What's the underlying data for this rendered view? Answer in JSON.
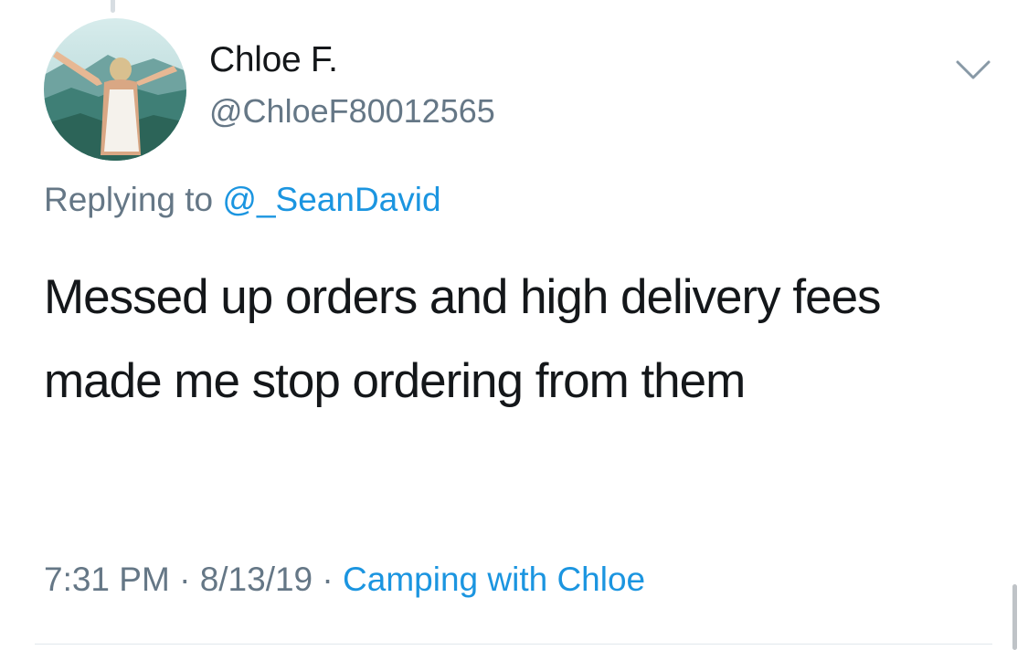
{
  "author": {
    "display_name": "Chloe F.",
    "handle": "@ChloeF80012565",
    "avatar_icon": "profile-photo-mountain"
  },
  "reply": {
    "prefix": "Replying to ",
    "mention": "@_SeanDavid"
  },
  "tweet": {
    "text": "Messed up orders and high delivery fees made me stop ordering from them"
  },
  "meta": {
    "time": "7:31 PM",
    "separator": " · ",
    "date": "8/13/19",
    "source": "Camping with Chloe"
  },
  "icons": {
    "menu": "chevron-down-icon"
  },
  "colors": {
    "text_primary": "#14171a",
    "text_secondary": "#657786",
    "link": "#1b95e0"
  }
}
